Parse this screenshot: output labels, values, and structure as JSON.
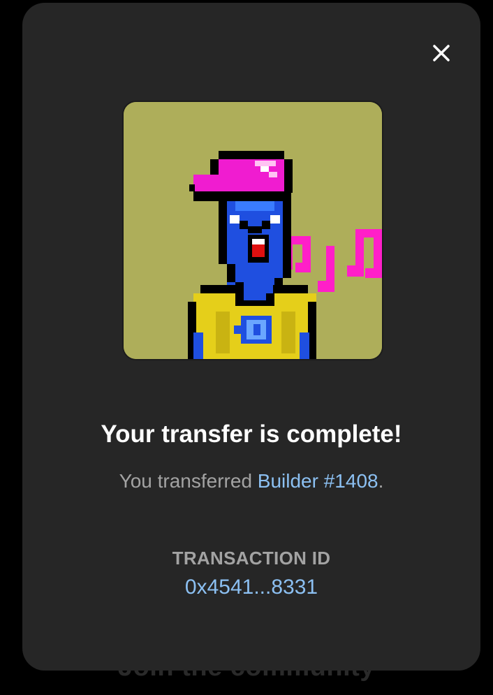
{
  "background": {
    "footer_text": "Join the community"
  },
  "modal": {
    "close_icon": "close-icon",
    "nft_image_icon": "pixel-art-builder-avatar",
    "title": "Your transfer is complete!",
    "subtitle_prefix": "You transferred ",
    "subtitle_link": "Builder #1408",
    "subtitle_suffix": ".",
    "transaction_label": "TRANSACTION ID",
    "transaction_id": "0x4541...8331"
  },
  "colors": {
    "modal_bg": "#262626",
    "page_bg": "#000000",
    "link": "#8cc0f2",
    "muted_text": "#a3a3a3",
    "nft_bg": "#aeae5a",
    "cap": "#f01cd0",
    "skin": "#1f4fe0",
    "shirt": "#e5cf1a",
    "notes": "#ff1fc8"
  }
}
